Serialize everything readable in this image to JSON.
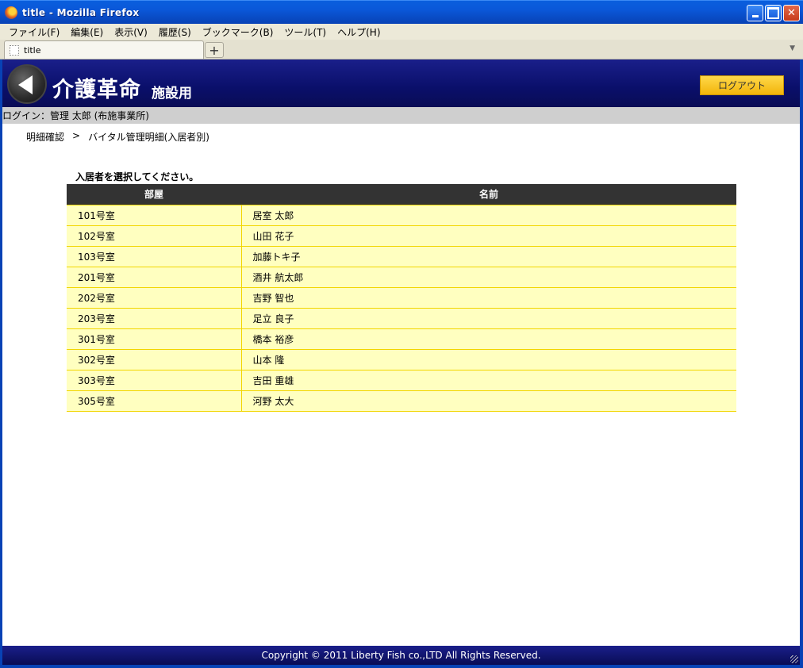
{
  "window": {
    "title": "title - Mozilla Firefox"
  },
  "menubar": {
    "items": [
      "ファイル(F)",
      "編集(E)",
      "表示(V)",
      "履歴(S)",
      "ブックマーク(B)",
      "ツール(T)",
      "ヘルプ(H)"
    ]
  },
  "tabs": {
    "active_label": "title",
    "new_tab_label": "+"
  },
  "header": {
    "app_title": "介護革命",
    "app_subtitle": "施設用",
    "logout_label": "ログアウト"
  },
  "login_bar": {
    "text": "ログイン：管理 太郎 (布施事業所)"
  },
  "breadcrumb": {
    "items": [
      "明細確認",
      "バイタル管理明細(入居者別)"
    ],
    "separator": ">"
  },
  "main": {
    "instruction": "入居者を選択してください。",
    "table": {
      "headers": [
        "部屋",
        "名前"
      ],
      "rows": [
        {
          "room": "101号室",
          "name": "居室 太郎"
        },
        {
          "room": "102号室",
          "name": "山田 花子"
        },
        {
          "room": "103号室",
          "name": "加藤トキ子"
        },
        {
          "room": "201号室",
          "name": "酒井 航太郎"
        },
        {
          "room": "202号室",
          "name": "吉野 智也"
        },
        {
          "room": "203号室",
          "name": "足立 良子"
        },
        {
          "room": "301号室",
          "name": "橋本 裕彦"
        },
        {
          "room": "302号室",
          "name": "山本 隆"
        },
        {
          "room": "303号室",
          "name": "吉田 重雄"
        },
        {
          "room": "305号室",
          "name": "河野 太大"
        }
      ]
    }
  },
  "footer": {
    "copyright": "Copyright © 2011 Liberty Fish co.,LTD All Rights Reserved."
  },
  "colors": {
    "header_bg": "#0a0f6a",
    "logout_bg": "#f2b40a",
    "table_header_bg": "#333333",
    "table_row_bg": "#ffffc0",
    "table_border": "#f2d600"
  }
}
